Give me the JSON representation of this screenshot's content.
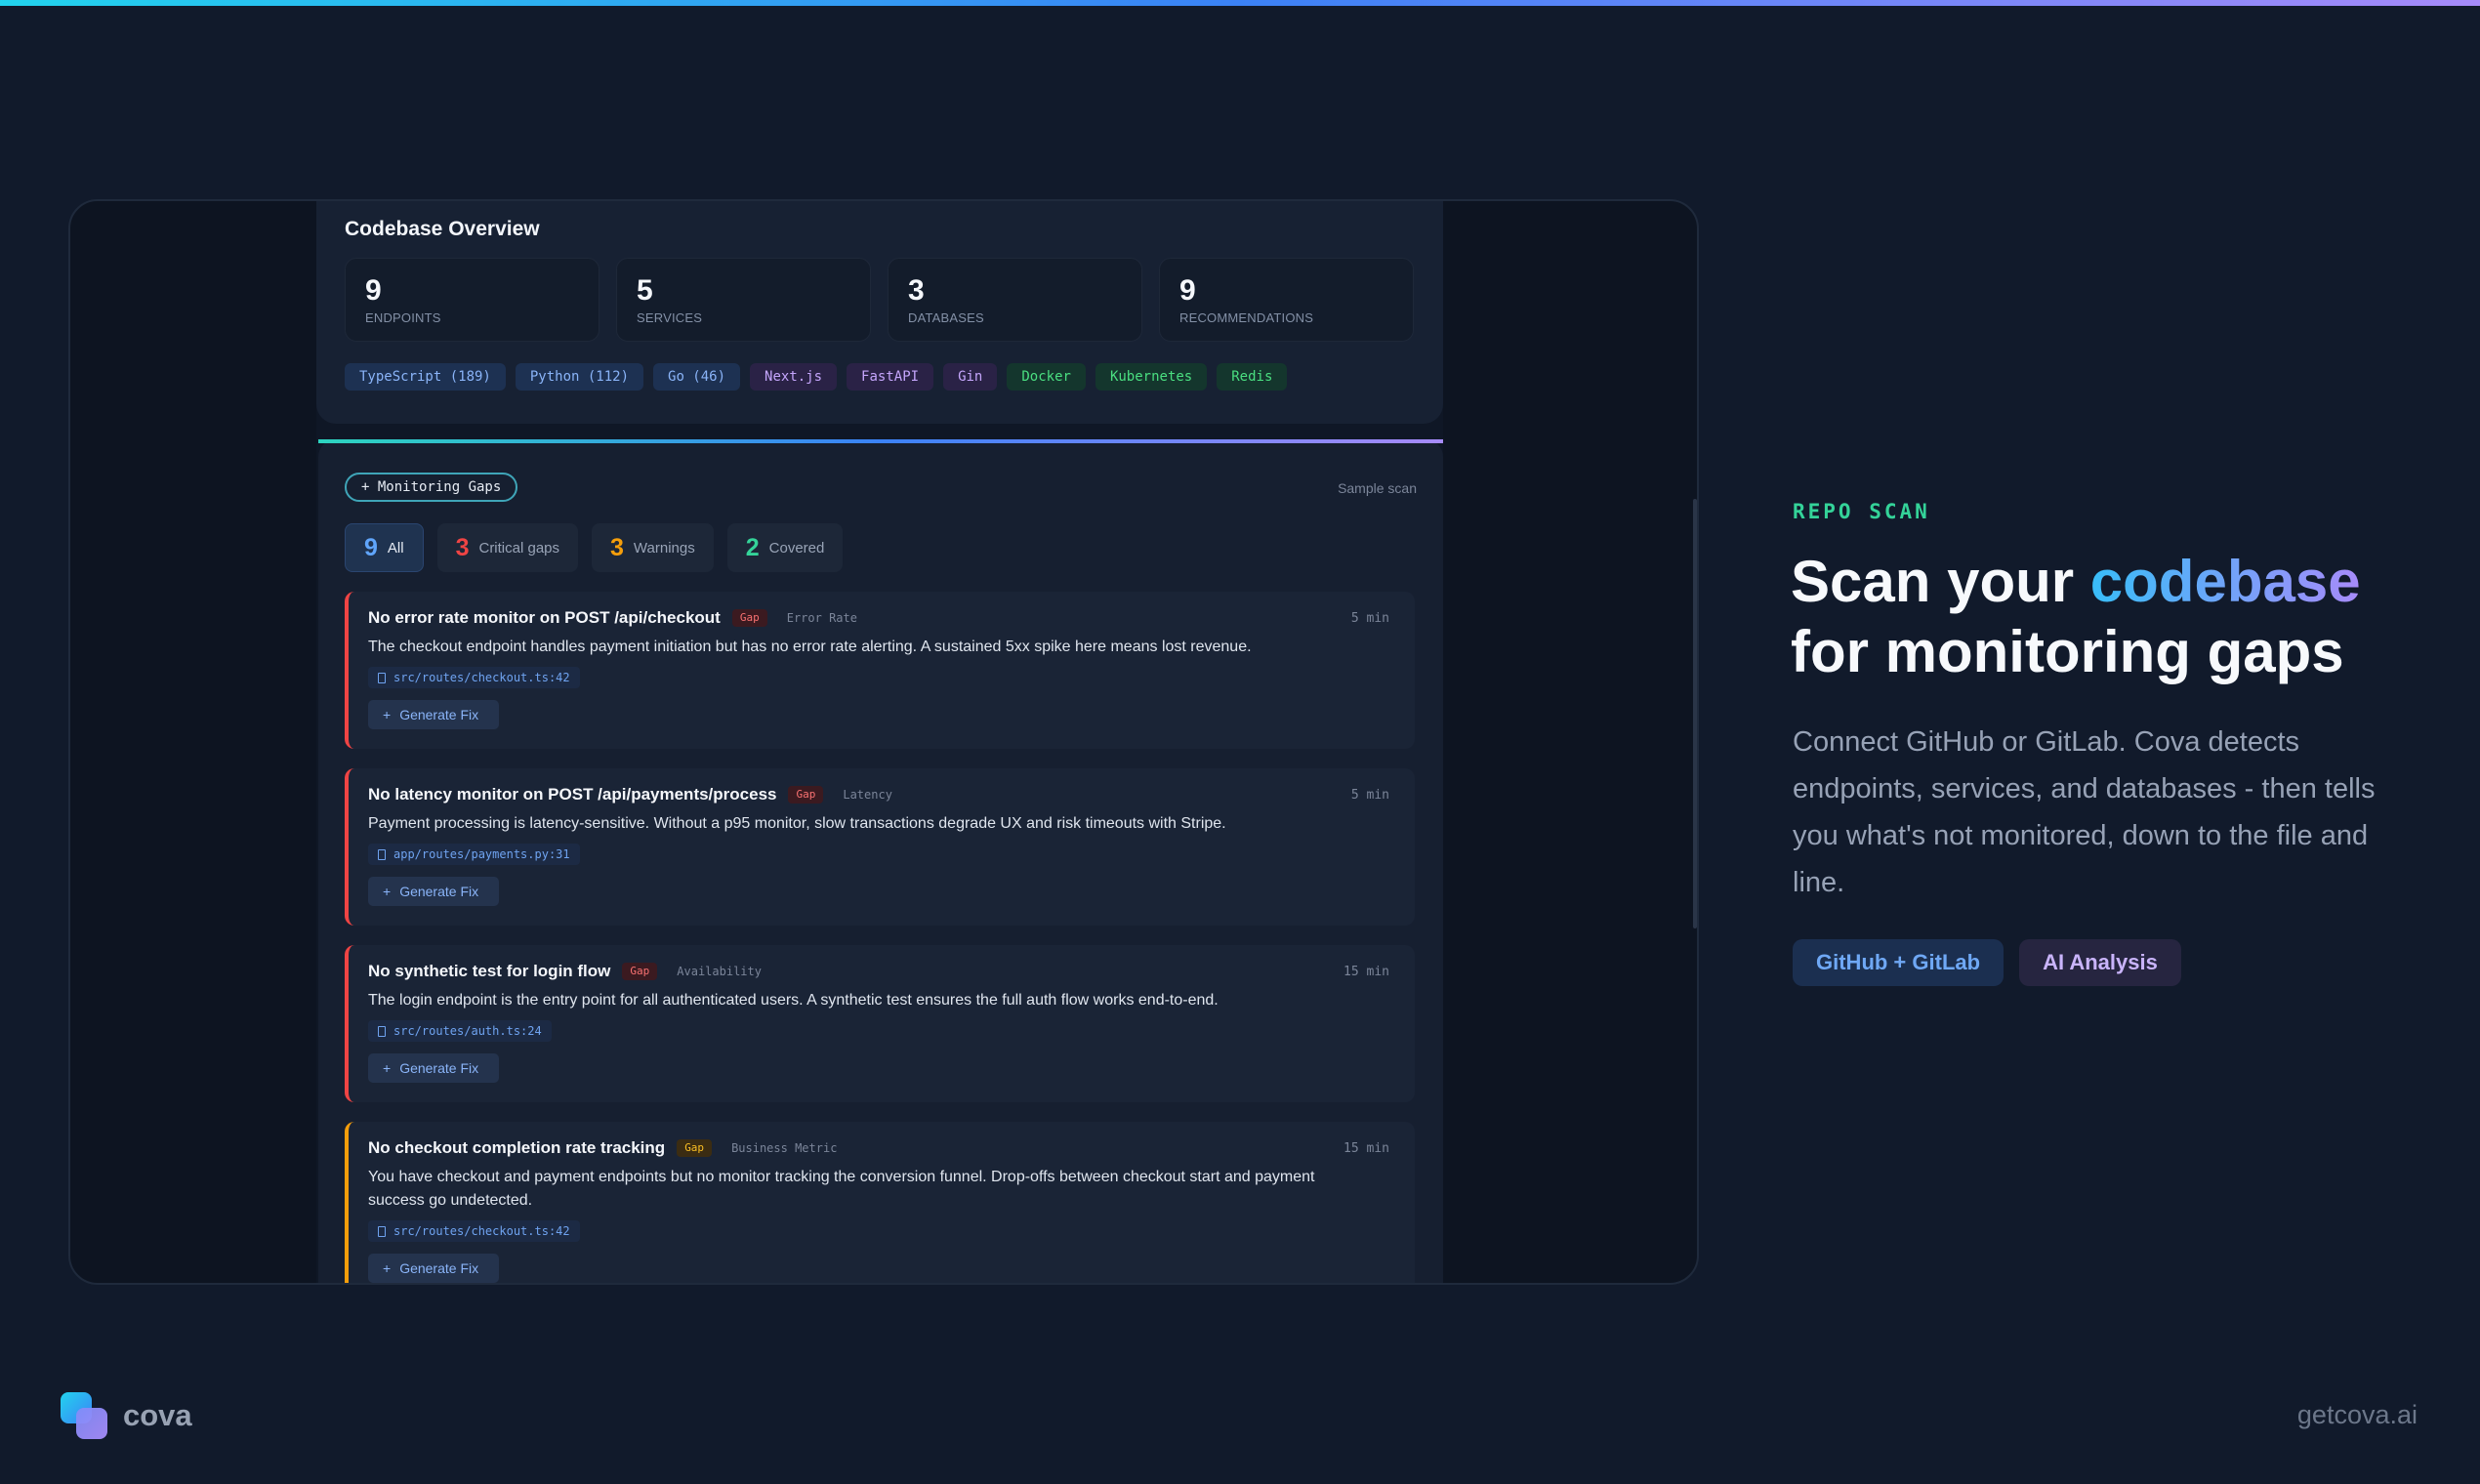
{
  "overview": {
    "title": "Codebase Overview",
    "stats": [
      {
        "value": "9",
        "label": "ENDPOINTS"
      },
      {
        "value": "5",
        "label": "SERVICES"
      },
      {
        "value": "3",
        "label": "DATABASES"
      },
      {
        "value": "9",
        "label": "RECOMMENDATIONS"
      }
    ],
    "tags": [
      {
        "label": "TypeScript (189)",
        "color": "blue"
      },
      {
        "label": "Python (112)",
        "color": "blue"
      },
      {
        "label": "Go (46)",
        "color": "blue"
      },
      {
        "label": "Next.js",
        "color": "purple"
      },
      {
        "label": "FastAPI",
        "color": "purple"
      },
      {
        "label": "Gin",
        "color": "purple"
      },
      {
        "label": "Docker",
        "color": "green"
      },
      {
        "label": "Kubernetes",
        "color": "green"
      },
      {
        "label": "Redis",
        "color": "green"
      }
    ]
  },
  "gaps": {
    "pill": "+ Monitoring Gaps",
    "sample": "Sample scan",
    "filters": [
      {
        "count": "9",
        "label": "All",
        "color": "#60a5fa",
        "active": true
      },
      {
        "count": "3",
        "label": "Critical gaps",
        "color": "#ef4444",
        "active": false
      },
      {
        "count": "3",
        "label": "Warnings",
        "color": "#f59e0b",
        "active": false
      },
      {
        "count": "2",
        "label": "Covered",
        "color": "#34d399",
        "active": false
      }
    ],
    "items": [
      {
        "title": "No error rate monitor on POST /api/checkout",
        "badge": "Gap",
        "category": "Error Rate",
        "time": "5 min",
        "desc": "The checkout endpoint handles payment initiation but has no error rate alerting. A sustained 5xx spike here means lost revenue.",
        "file": "src/routes/checkout.ts:42",
        "fix": "Generate Fix",
        "severity": "critical"
      },
      {
        "title": "No latency monitor on POST /api/payments/process",
        "badge": "Gap",
        "category": "Latency",
        "time": "5 min",
        "desc": "Payment processing is latency-sensitive. Without a p95 monitor, slow transactions degrade UX and risk timeouts with Stripe.",
        "file": "app/routes/payments.py:31",
        "fix": "Generate Fix",
        "severity": "critical"
      },
      {
        "title": "No synthetic test for login flow",
        "badge": "Gap",
        "category": "Availability",
        "time": "15 min",
        "desc": "The login endpoint is the entry point for all authenticated users. A synthetic test ensures the full auth flow works end-to-end.",
        "file": "src/routes/auth.ts:24",
        "fix": "Generate Fix",
        "severity": "critical"
      },
      {
        "title": "No checkout completion rate tracking",
        "badge": "Gap",
        "category": "Business Metric",
        "time": "15 min",
        "desc": "You have checkout and payment endpoints but no monitor tracking the conversion funnel. Drop-offs between checkout start and payment success go undetected.",
        "file": "src/routes/checkout.ts:42",
        "fix": "Generate Fix",
        "severity": "warning"
      }
    ]
  },
  "hero": {
    "kicker": "REPO SCAN",
    "headline_a": "Scan your ",
    "headline_hl": "codebase",
    "headline_b": "for monitoring gaps",
    "subcopy": "Connect GitHub or GitLab. Cova detects endpoints, services, and databases - then tells you what's not monitored, down to the file and line.",
    "chips": [
      "GitHub + GitLab",
      "AI Analysis"
    ]
  },
  "footer": {
    "brand": "cova",
    "domain": "getcova.ai"
  }
}
